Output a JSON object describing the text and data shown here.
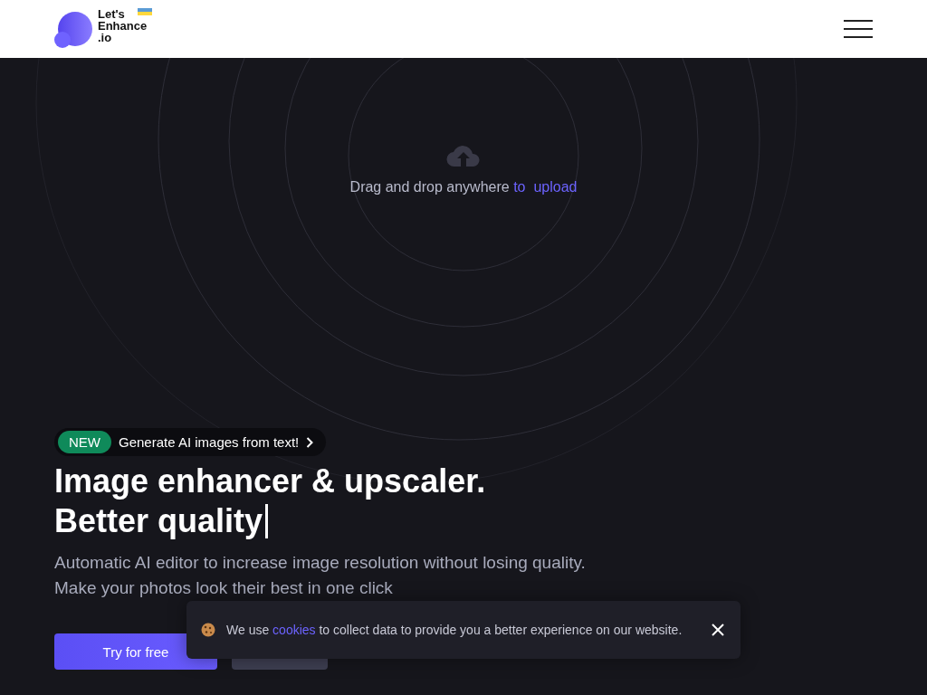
{
  "header": {
    "logo_lines": [
      "Let's",
      "Enhance",
      ".io"
    ]
  },
  "upload": {
    "text": "Drag and drop anywhere",
    "link": "to  upload"
  },
  "promo": {
    "badge": "NEW",
    "text": "Generate AI images from text!"
  },
  "hero": {
    "title_lines": [
      "Image enhancer & upscaler.",
      "Better quality"
    ],
    "description_lines": [
      "Automatic AI editor to increase image resolution without losing quality.",
      "Make your photos look their best in one click"
    ]
  },
  "buttons": [
    {
      "label": "Try for free",
      "kind": "primary"
    },
    {
      "kind": "secondary"
    }
  ],
  "cookie_banner": {
    "text_before": "We use",
    "link": "cookies",
    "text_after": "to collect data to provide you a better experience on our website."
  }
}
